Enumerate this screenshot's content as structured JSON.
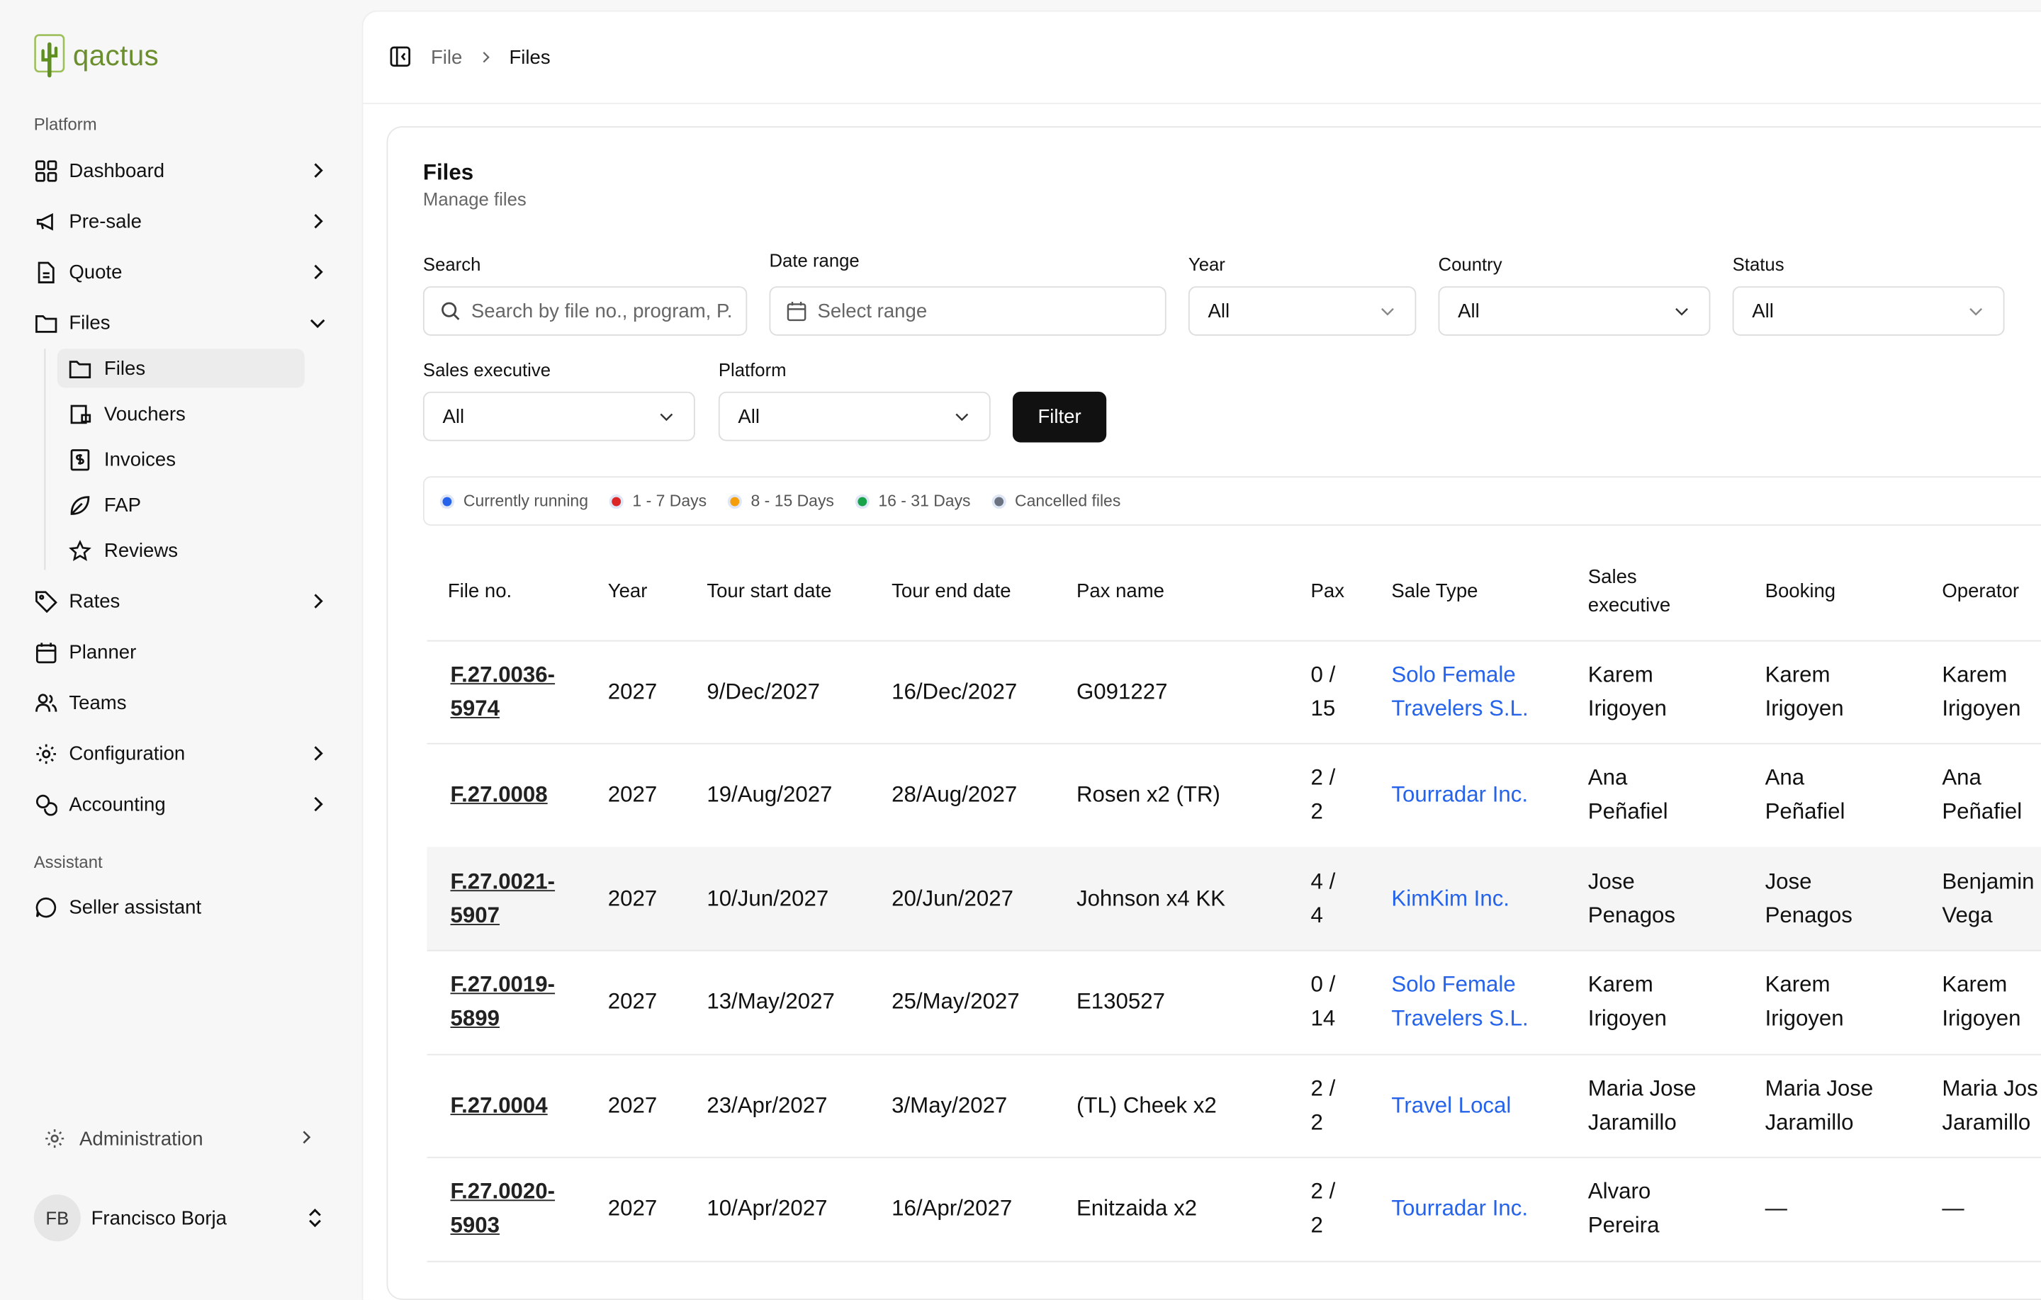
{
  "app": {
    "logo_text": "qactus"
  },
  "sidebar": {
    "platform_label": "Platform",
    "items": [
      {
        "label": "Dashboard",
        "icon": "grid-icon",
        "chevron": true
      },
      {
        "label": "Pre-sale",
        "icon": "megaphone-icon",
        "chevron": true
      },
      {
        "label": "Quote",
        "icon": "document-icon",
        "chevron": true
      },
      {
        "label": "Files",
        "icon": "folder-icon",
        "chevron": true,
        "expanded": true
      }
    ],
    "files_sub": [
      {
        "label": "Files",
        "icon": "folder-icon",
        "active": true
      },
      {
        "label": "Vouchers",
        "icon": "voucher-icon"
      },
      {
        "label": "Invoices",
        "icon": "invoice-icon"
      },
      {
        "label": "FAP",
        "icon": "leaf-icon"
      },
      {
        "label": "Reviews",
        "icon": "star-icon"
      }
    ],
    "items2": [
      {
        "label": "Rates",
        "icon": "tag-icon",
        "chevron": true
      },
      {
        "label": "Planner",
        "icon": "calendar-icon"
      },
      {
        "label": "Teams",
        "icon": "users-icon"
      },
      {
        "label": "Configuration",
        "icon": "gear-icon",
        "chevron": true
      },
      {
        "label": "Accounting",
        "icon": "coins-icon",
        "chevron": true
      }
    ],
    "assistant_label": "Assistant",
    "seller_assistant": "Seller assistant",
    "administration": "Administration",
    "user": {
      "initials": "FB",
      "name": "Francisco Borja"
    }
  },
  "breadcrumb": {
    "parent": "File",
    "current": "Files"
  },
  "card": {
    "title": "Files",
    "subtitle": "Manage files"
  },
  "filters": {
    "search_label": "Search",
    "search_placeholder": "Search by file no., program, P.",
    "date_label": "Date range",
    "date_placeholder": "Select range",
    "year_label": "Year",
    "year_value": "All",
    "country_label": "Country",
    "country_value": "All",
    "status_label": "Status",
    "status_value": "All",
    "sales_label": "Sales executive",
    "sales_value": "All",
    "platform_label": "Platform",
    "platform_value": "All",
    "filter_button": "Filter"
  },
  "legend": [
    {
      "label": "Currently running",
      "color": "#2563eb"
    },
    {
      "label": "1 - 7 Days",
      "color": "#dc2626"
    },
    {
      "label": "8 - 15 Days",
      "color": "#f59e0b"
    },
    {
      "label": "16 - 31 Days",
      "color": "#16a34a"
    },
    {
      "label": "Cancelled files",
      "color": "#6b7280"
    }
  ],
  "table": {
    "headers": {
      "file": "File no.",
      "year": "Year",
      "start": "Tour start date",
      "end": "Tour end date",
      "pax_name": "Pax name",
      "pax": "Pax",
      "sale_type": "Sale Type",
      "sales_a": "Sales",
      "sales_b": "executive",
      "booking": "Booking",
      "operator": "Operator"
    },
    "rows": [
      {
        "file_a": "F.27.0036-",
        "file_b": "5974",
        "year": "2027",
        "start": "9/Dec/2027",
        "end": "16/Dec/2027",
        "pax_name": "G091227",
        "pax_a": "0 /",
        "pax_b": "15",
        "sale_a": "Solo Female",
        "sale_b": "Travelers S.L.",
        "sales_a": "Karem",
        "sales_b": "Irigoyen",
        "booking_a": "Karem",
        "booking_b": "Irigoyen",
        "op_a": "Karem",
        "op_b": "Irigoyen"
      },
      {
        "file_a": "F.27.0008",
        "file_b": "",
        "year": "2027",
        "start": "19/Aug/2027",
        "end": "28/Aug/2027",
        "pax_name": "Rosen x2 (TR)",
        "pax_a": "2 /",
        "pax_b": "2",
        "sale_a": "Tourradar Inc.",
        "sale_b": "",
        "sales_a": "Ana",
        "sales_b": "Peñafiel",
        "booking_a": "Ana",
        "booking_b": "Peñafiel",
        "op_a": "Ana",
        "op_b": "Peñafiel"
      },
      {
        "file_a": "F.27.0021-",
        "file_b": "5907",
        "year": "2027",
        "start": "10/Jun/2027",
        "end": "20/Jun/2027",
        "pax_name": "Johnson x4 KK",
        "pax_a": "4 /",
        "pax_b": "4",
        "sale_a": "KimKim Inc.",
        "sale_b": "",
        "sales_a": "Jose",
        "sales_b": "Penagos",
        "booking_a": "Jose",
        "booking_b": "Penagos",
        "op_a": "Benjamin",
        "op_b": "Vega"
      },
      {
        "file_a": "F.27.0019-",
        "file_b": "5899",
        "year": "2027",
        "start": "13/May/2027",
        "end": "25/May/2027",
        "pax_name": "E130527",
        "pax_a": "0 /",
        "pax_b": "14",
        "sale_a": "Solo Female",
        "sale_b": "Travelers S.L.",
        "sales_a": "Karem",
        "sales_b": "Irigoyen",
        "booking_a": "Karem",
        "booking_b": "Irigoyen",
        "op_a": "Karem",
        "op_b": "Irigoyen"
      },
      {
        "file_a": "F.27.0004",
        "file_b": "",
        "year": "2027",
        "start": "23/Apr/2027",
        "end": "3/May/2027",
        "pax_name": "(TL) Cheek x2",
        "pax_a": "2 /",
        "pax_b": "2",
        "sale_a": "Travel Local",
        "sale_b": "",
        "sales_a": "Maria Jose",
        "sales_b": "Jaramillo",
        "booking_a": "Maria Jose",
        "booking_b": "Jaramillo",
        "op_a": "Maria Jos",
        "op_b": "Jaramillo"
      },
      {
        "file_a": "F.27.0020-",
        "file_b": "5903",
        "year": "2027",
        "start": "10/Apr/2027",
        "end": "16/Apr/2027",
        "pax_name": "Enitzaida x2",
        "pax_a": "2 /",
        "pax_b": "2",
        "sale_a": "Tourradar Inc.",
        "sale_b": "",
        "sales_a": "Alvaro",
        "sales_b": "Pereira",
        "booking_a": "—",
        "booking_b": "",
        "op_a": "—",
        "op_b": ""
      }
    ]
  }
}
